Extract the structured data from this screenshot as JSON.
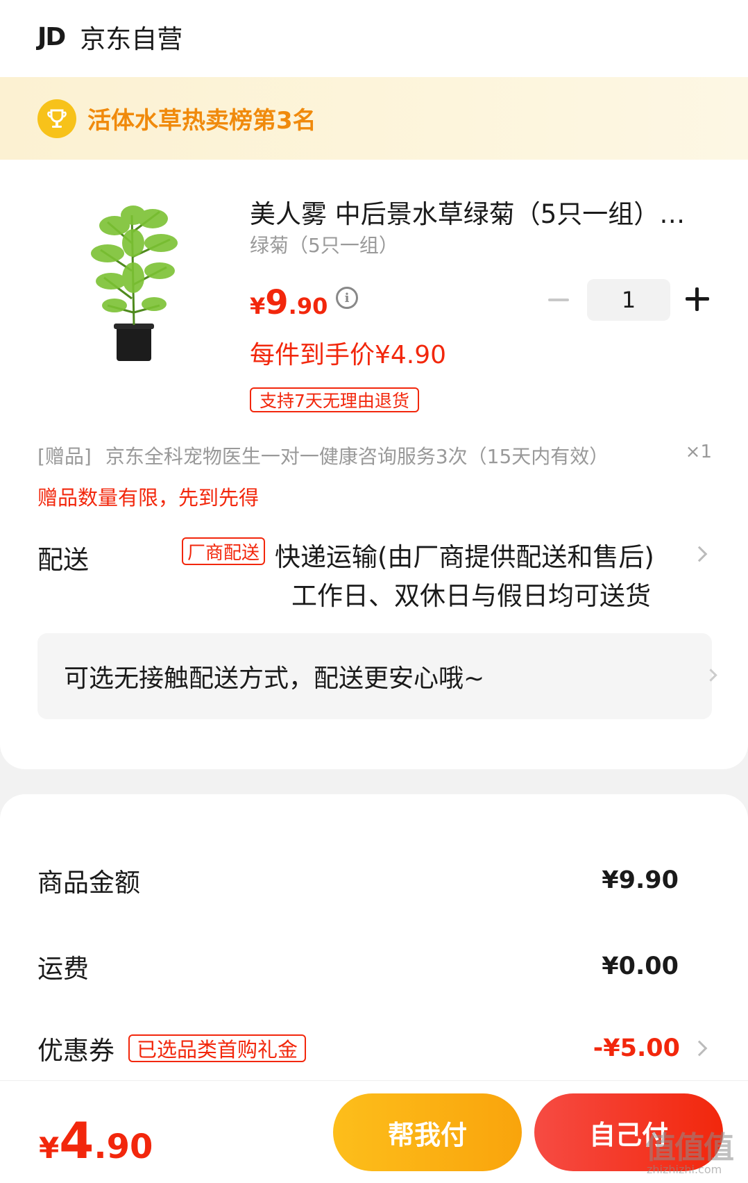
{
  "store": {
    "logo": "JD",
    "name": "京东自营"
  },
  "rank_banner": {
    "text": "活体水草热卖榜第3名"
  },
  "product": {
    "title": "美人雾 中后景水草绿菊（5只一组）…",
    "spec": "绿菊（5只一组）",
    "price_symbol": "¥",
    "price_int": "9",
    "price_dec": ".90",
    "net_price": "每件到手价¥4.90",
    "quantity": "1",
    "return_tag": "支持7天无理由退货"
  },
  "gift": {
    "tag": "[赠品]",
    "name": "京东全科宠物医生一对一健康咨询服务3次（15天内有效）",
    "qty": "×1",
    "warning": "赠品数量有限，先到先得"
  },
  "delivery": {
    "label": "配送",
    "vendor_tag": "厂商配送",
    "main": "快递运输(由厂商提供配送和售后)",
    "sub": "工作日、双休日与假日均可送货",
    "contactless": "可选无接触配送方式，配送更安心哦~"
  },
  "summary": {
    "goods_label": "商品金额",
    "goods_value": "¥9.90",
    "shipping_label": "运费",
    "shipping_value": "¥0.00",
    "coupon_label": "优惠券",
    "coupon_tag": "已选品类首购礼金",
    "coupon_value": "-¥5.00"
  },
  "bottom": {
    "total_symbol": "¥",
    "total_int": "4",
    "total_dec": ".90",
    "help_pay": "帮我付",
    "self_pay": "自己付",
    "watermark": "值值值",
    "watermark_url": "zhizhizhi.com"
  },
  "colors": {
    "accent": "#f2270c",
    "gold": "#f9a40c",
    "banner_text": "#f08a0c"
  }
}
